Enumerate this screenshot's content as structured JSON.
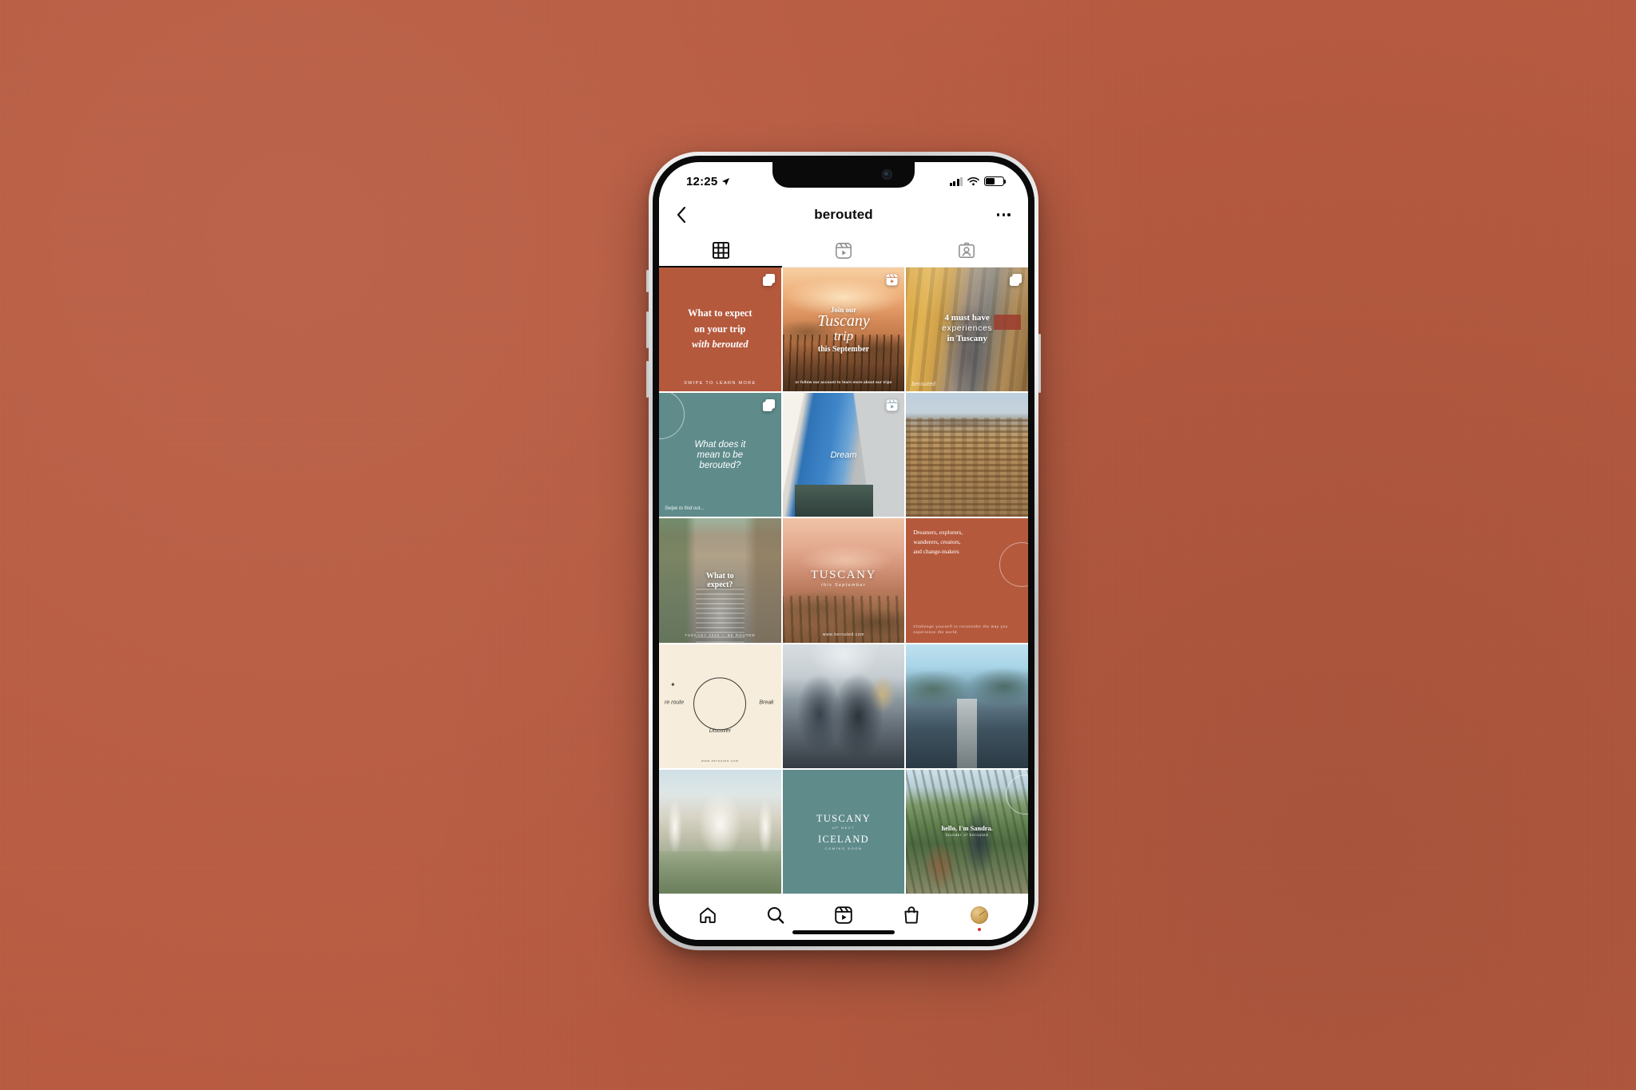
{
  "colors": {
    "backdrop": "#b85b41",
    "terracotta": "#b5593d",
    "teal": "#5f8b8b",
    "cream": "#f6eddc",
    "accent_gold": "#c79b4e",
    "notification_red": "#d93025"
  },
  "status_bar": {
    "time": "12:25",
    "location_icon": "location-arrow-icon",
    "signal_icon": "cellular-signal-icon",
    "wifi_icon": "wifi-icon",
    "battery_icon": "battery-icon"
  },
  "header": {
    "back_icon": "back-chevron-icon",
    "username": "berouted",
    "more_icon": "more-options-icon"
  },
  "profile_tabs": [
    {
      "name": "grid",
      "icon": "grid-icon",
      "active": true
    },
    {
      "name": "reels",
      "icon": "reels-icon",
      "active": false
    },
    {
      "name": "tagged",
      "icon": "tagged-person-icon",
      "active": false
    }
  ],
  "grid": {
    "posts": [
      {
        "id": 1,
        "style": "terracotta",
        "badge": "carousel-icon",
        "lines": [
          "What to expect",
          "on your trip",
          "with berouted"
        ],
        "emphasis": "berouted",
        "footer": "SWIPE TO LEARN MORE"
      },
      {
        "id": 2,
        "style": "tuscany-hills",
        "badge": "reels-icon",
        "lines": [
          "Join our",
          "Tuscany",
          "trip",
          "this September"
        ],
        "footer": "or follow our account to learn more about our trips"
      },
      {
        "id": 3,
        "style": "street-yellow",
        "badge": "carousel-icon",
        "lines": [
          "4 must have",
          "experiences",
          "in Tuscany"
        ],
        "watermark": "berouted"
      },
      {
        "id": 4,
        "style": "teal",
        "badge": "carousel-icon",
        "lines": [
          "What does it",
          "mean to be",
          "berouted?"
        ],
        "footer": "Swipe to find out..."
      },
      {
        "id": 5,
        "style": "sky-wall",
        "badge": "reels-icon",
        "lines": [
          "Dream"
        ]
      },
      {
        "id": 6,
        "style": "rooftops",
        "badge": "",
        "lines": []
      },
      {
        "id": 7,
        "style": "stone-street",
        "badge": "",
        "lines": [
          "What to",
          "expect?"
        ],
        "footer": "TUSCANY 2022 — BE ROUTED"
      },
      {
        "id": 8,
        "style": "tuscany-sunset",
        "badge": "",
        "lines": [
          "TUSCANY"
        ],
        "subline": "this September",
        "footer": "www.berouted.com"
      },
      {
        "id": 9,
        "style": "terracotta",
        "badge": "",
        "lines": [
          "Dreamers, explorers,",
          "wanderers, creators,",
          "and change-makers"
        ],
        "footer": "Challenge yourself to reconsider the way you experience the world."
      },
      {
        "id": 10,
        "style": "cream",
        "badge": "",
        "ring_labels": {
          "left": "re route",
          "right": "Break",
          "bottom": "Discover"
        },
        "footer": "www.berouted.com"
      },
      {
        "id": 11,
        "style": "hikers",
        "badge": "",
        "lines": []
      },
      {
        "id": 12,
        "style": "lake-pier",
        "badge": "",
        "lines": []
      },
      {
        "id": 13,
        "style": "palace",
        "badge": "",
        "lines": []
      },
      {
        "id": 14,
        "style": "teal",
        "badge": "",
        "lines": [
          "TUSCANY"
        ],
        "sub1": "UP NEXT",
        "lines2": [
          "ICELAND"
        ],
        "sub2": "COMING SOON"
      },
      {
        "id": 15,
        "style": "hillside",
        "badge": "",
        "lines": [
          "hello, I'm Sandra."
        ],
        "footer": "founder of berouted"
      }
    ]
  },
  "bottom_nav": [
    {
      "name": "home",
      "icon": "home-icon"
    },
    {
      "name": "search",
      "icon": "search-icon"
    },
    {
      "name": "reels",
      "icon": "reels-icon"
    },
    {
      "name": "shop",
      "icon": "shop-bag-icon"
    },
    {
      "name": "profile",
      "icon": "profile-avatar-icon",
      "has_badge": true
    }
  ]
}
